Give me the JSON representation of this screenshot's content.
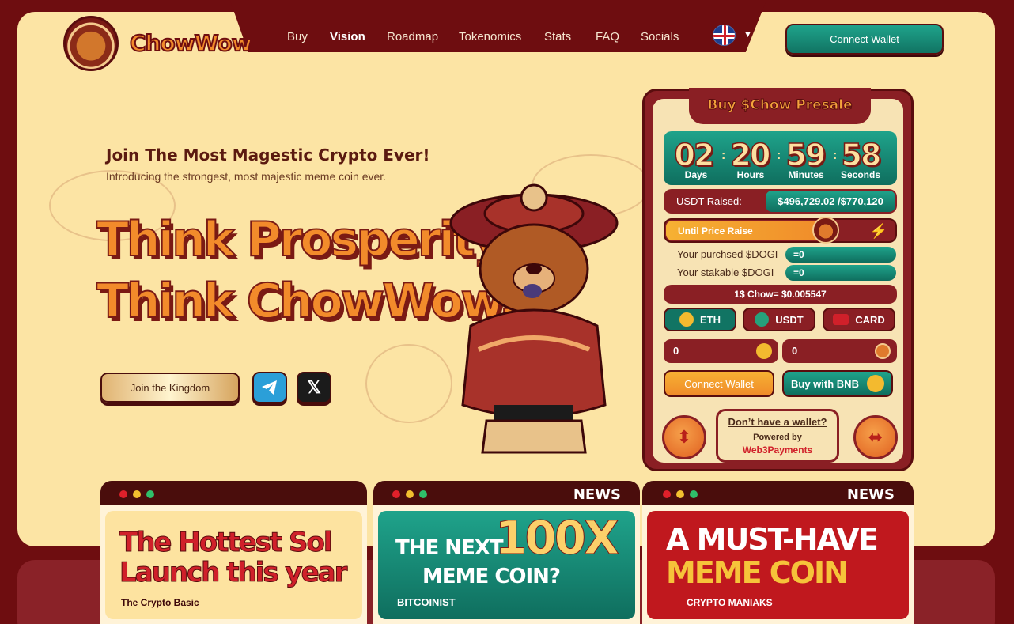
{
  "brand": {
    "name": "ChowWow"
  },
  "nav": {
    "items": [
      "Buy",
      "Vision",
      "Roadmap",
      "Tokenomics",
      "Stats",
      "FAQ",
      "Socials"
    ],
    "active": "Vision",
    "language_icon": "uk-flag-icon",
    "connect_wallet": "Connect Wallet"
  },
  "hero": {
    "heading": "Join The Most Magestic Crypto Ever!",
    "subheading": "Introducing the strongest, most majestic meme coin ever.",
    "headline_1": "Think Prosperity,",
    "headline_2": "Think ChowWow.",
    "cta": "Join the Kingdom",
    "socials": [
      "telegram-icon",
      "x-icon"
    ]
  },
  "presale": {
    "title": "Buy $Chow Presale",
    "countdown": {
      "days": "02",
      "hours": "20",
      "minutes": "59",
      "seconds": "58",
      "days_label": "Days",
      "hours_label": "Hours",
      "minutes_label": "Minutes",
      "seconds_label": "Seconds"
    },
    "raised_label": "USDT Raised:",
    "raised_value": "$496,729.02 /$770,120",
    "until_label": "Until Price Raise",
    "progress_fraction": 0.7,
    "purchased_label": "Your purchsed $DOGI",
    "purchased_value": "=0",
    "stakable_label": "Your stakable $DOGI",
    "stakable_value": "=0",
    "rate": "1$ Chow= $0.005547",
    "currencies": [
      "ETH",
      "USDT",
      "CARD"
    ],
    "selected_currency": "ETH",
    "pay_amount": "0",
    "receive_amount": "0",
    "connect_wallet": "Connect Wallet",
    "buy_bnb": "Buy with BNB",
    "no_wallet": "Don’t have a wallet?",
    "powered_by": "Powered by",
    "powered_name": "Web3Payments"
  },
  "news": [
    {
      "tag": "",
      "line1": "The Hottest Sol",
      "line2": "Launch this year",
      "source": "The Crypto Basic"
    },
    {
      "tag": "NEWS",
      "line1": "THE NEXT",
      "big": "100X",
      "line2": "MEME COIN?",
      "source": "BITCOINIST"
    },
    {
      "tag": "NEWS",
      "line1": "A MUST-HAVE",
      "line2": "MEME COIN",
      "source": "CRYPTO MANIAKS"
    }
  ],
  "colors": {
    "maroon": "#6e0d10",
    "cream": "#fce4a4",
    "orange": "#f28b2b",
    "teal": "#117463",
    "red": "#8a1f24"
  }
}
